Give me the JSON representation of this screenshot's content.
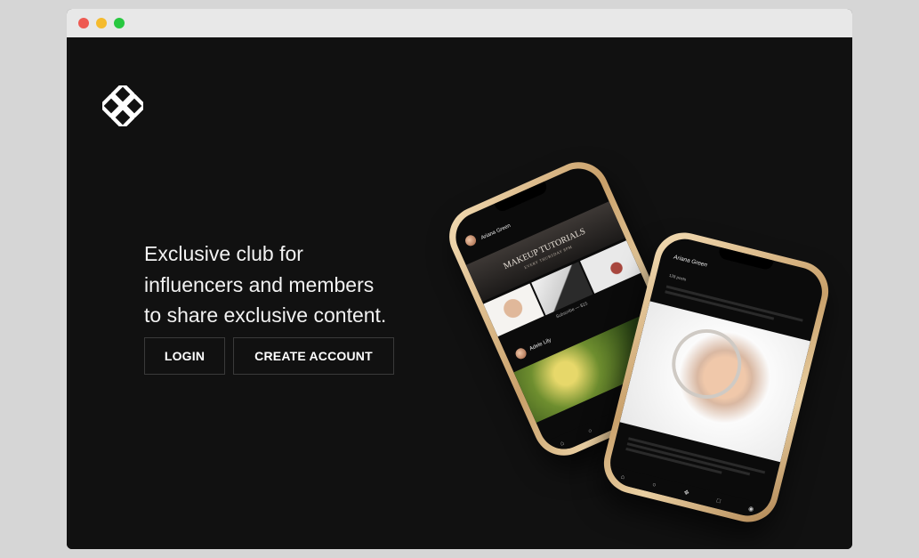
{
  "window": {
    "traffic_lights": [
      "close",
      "minimize",
      "zoom"
    ]
  },
  "brand": {
    "logo_icon": "interlaced-knot-logo-icon"
  },
  "hero": {
    "headline_lines": [
      "Exclusive club for",
      "influencers and members",
      "to share exclusive content."
    ]
  },
  "actions": {
    "login_label": "LOGIN",
    "create_account_label": "CREATE ACCOUNT"
  },
  "phone_left": {
    "profile_name": "Ariana Green",
    "banner_title": "MAKEUP TUTORIALS",
    "banner_sub": "EVERY THURSDAY 8PM",
    "subscribe_text": "Subscribe — $15",
    "second_user": "Adele Lily"
  },
  "phone_right": {
    "header_name": "Ariana Green",
    "posts_count": "128 posts"
  },
  "colors": {
    "background": "#111111",
    "accent_gold": "#d8b98a",
    "text": "#f2f2f2"
  }
}
